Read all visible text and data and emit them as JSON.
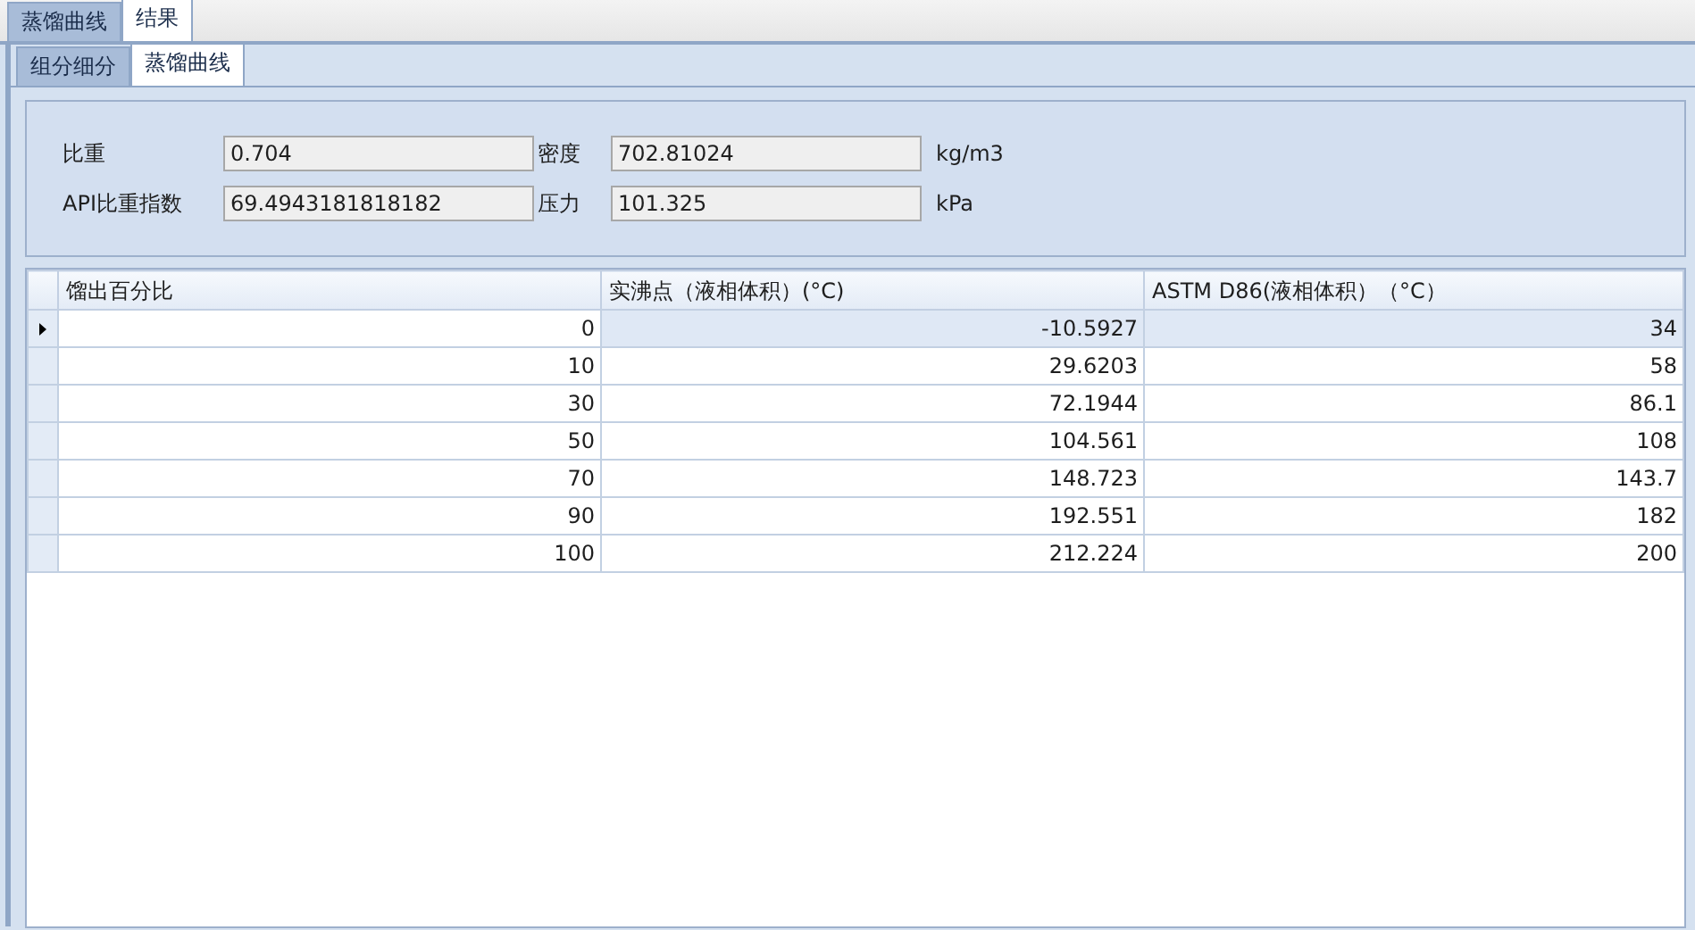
{
  "outer_tabs": [
    {
      "label": "蒸馏曲线",
      "selected": false
    },
    {
      "label": "结果",
      "selected": true
    }
  ],
  "inner_tabs": [
    {
      "label": "组分细分",
      "selected": false
    },
    {
      "label": "蒸馏曲线",
      "selected": true
    }
  ],
  "properties": [
    {
      "label": "比重",
      "value": "0.704"
    },
    {
      "label": "密度",
      "value": "702.81024",
      "unit": "kg/m3"
    },
    {
      "label": "API比重指数",
      "value": "69.4943181818182"
    },
    {
      "label": "压力",
      "value": "101.325",
      "unit": "kPa"
    }
  ],
  "table": {
    "columns": [
      "馏出百分比",
      "实沸点（液相体积）(°C)",
      "ASTM D86(液相体积）（°C）"
    ],
    "rows": [
      {
        "cells": [
          "0",
          "-10.5927",
          "34"
        ],
        "selected": true
      },
      {
        "cells": [
          "10",
          "29.6203",
          "58"
        ],
        "selected": false
      },
      {
        "cells": [
          "30",
          "72.1944",
          "86.1"
        ],
        "selected": false
      },
      {
        "cells": [
          "50",
          "104.561",
          "108"
        ],
        "selected": false
      },
      {
        "cells": [
          "70",
          "148.723",
          "143.7"
        ],
        "selected": false
      },
      {
        "cells": [
          "90",
          "192.551",
          "182"
        ],
        "selected": false
      },
      {
        "cells": [
          "100",
          "212.224",
          "200"
        ],
        "selected": false
      }
    ]
  }
}
